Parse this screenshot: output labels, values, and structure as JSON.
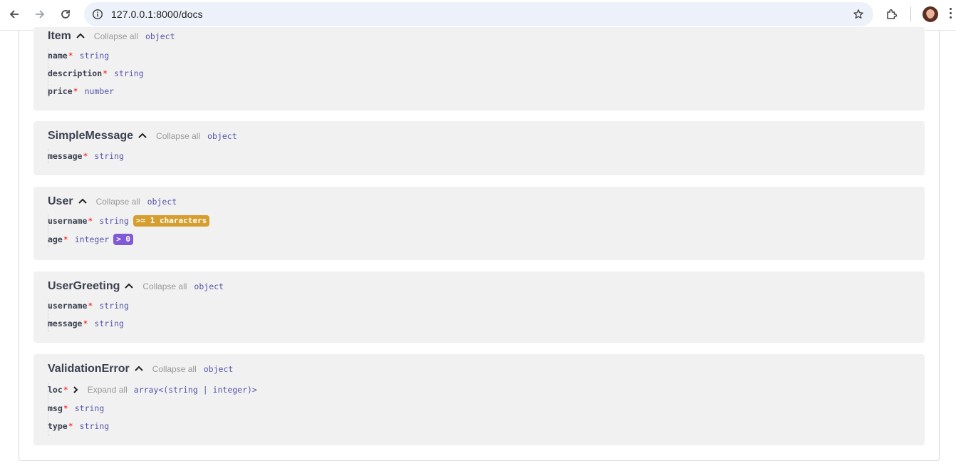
{
  "browser": {
    "url": "127.0.0.1:8000/docs"
  },
  "models": [
    {
      "title": "Item",
      "collapse_label": "Collapse all",
      "type": "object",
      "properties": [
        {
          "name": "name",
          "required_mark": "*",
          "type": "string"
        },
        {
          "name": "description",
          "required_mark": "*",
          "type": "string"
        },
        {
          "name": "price",
          "required_mark": "*",
          "type": "number"
        }
      ]
    },
    {
      "title": "SimpleMessage",
      "collapse_label": "Collapse all",
      "type": "object",
      "properties": [
        {
          "name": "message",
          "required_mark": "*",
          "type": "string"
        }
      ]
    },
    {
      "title": "User",
      "collapse_label": "Collapse all",
      "type": "object",
      "properties": [
        {
          "name": "username",
          "required_mark": "*",
          "type": "string",
          "badge": ">= 1 characters",
          "badge_color": "#d69e2e"
        },
        {
          "name": "age",
          "required_mark": "*",
          "type": "integer",
          "badge": "> 0",
          "badge_color": "#805ad5"
        }
      ]
    },
    {
      "title": "UserGreeting",
      "collapse_label": "Collapse all",
      "type": "object",
      "properties": [
        {
          "name": "username",
          "required_mark": "*",
          "type": "string"
        },
        {
          "name": "message",
          "required_mark": "*",
          "type": "string"
        }
      ]
    },
    {
      "title": "ValidationError",
      "collapse_label": "Collapse all",
      "type": "object",
      "properties": [
        {
          "name": "loc",
          "required_mark": "*",
          "expand_label": "Expand all",
          "type": "array<(string | integer)>"
        },
        {
          "name": "msg",
          "required_mark": "*",
          "type": "string"
        },
        {
          "name": "type",
          "required_mark": "*",
          "type": "string"
        }
      ]
    }
  ],
  "colors": {
    "required": "#ff0000",
    "type_text": "#5555aa",
    "model_bg": "#f1f1f1",
    "muted": "#999999"
  }
}
